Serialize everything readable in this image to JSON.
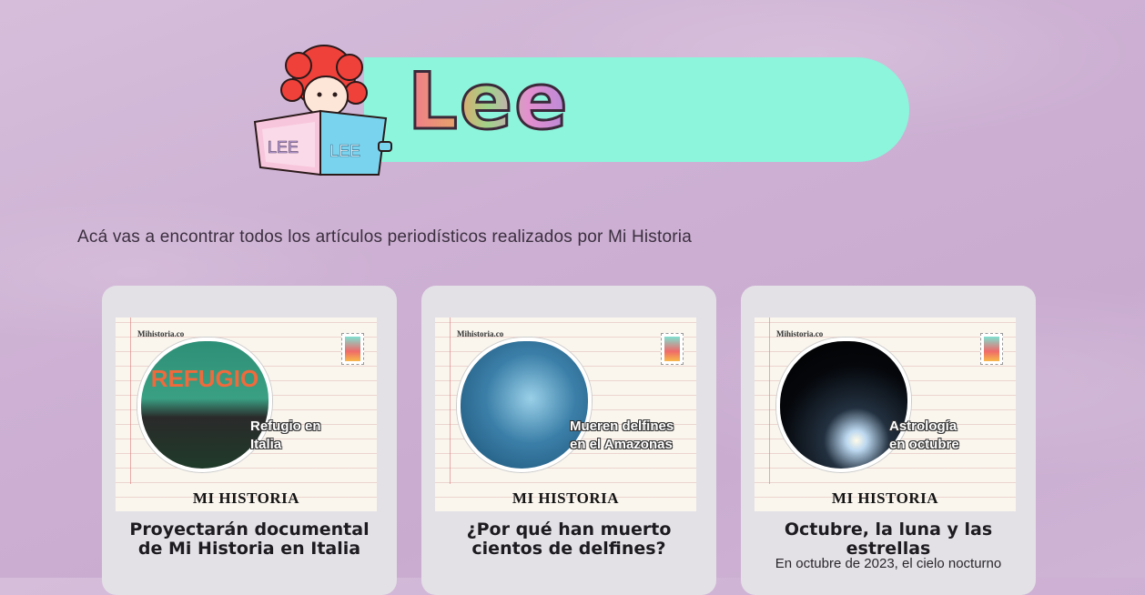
{
  "header": {
    "title": "Lee",
    "mascot_book_text": "LEE"
  },
  "intro": "Acá vas a encontrar todos los artículos periodísticos realizados por Mi Historia",
  "cards": [
    {
      "site": "Mihistoria.co",
      "caption_line1": "Refugio en",
      "caption_line2": "Italia",
      "poster_title": "REFUGIO",
      "brand": "MI HISTORIA",
      "title": "Proyectarán documental de Mi Historia en Italia",
      "excerpt": ""
    },
    {
      "site": "Mihistoria.co",
      "caption_line1": "Mueren delfines",
      "caption_line2": "en el Amazonas",
      "brand": "MI HISTORIA",
      "title": "¿Por qué han muerto cientos de delfines?",
      "excerpt": ""
    },
    {
      "site": "Mihistoria.co",
      "caption_line1": "Astrología",
      "caption_line2": "en octubre",
      "brand": "MI HISTORIA",
      "title": "Octubre, la luna y las estrellas",
      "excerpt": "En octubre de 2023, el cielo nocturno"
    }
  ],
  "colors": {
    "background": "#cdb0d3",
    "banner": "#8cf5dc",
    "card": "#e3e1e6"
  }
}
